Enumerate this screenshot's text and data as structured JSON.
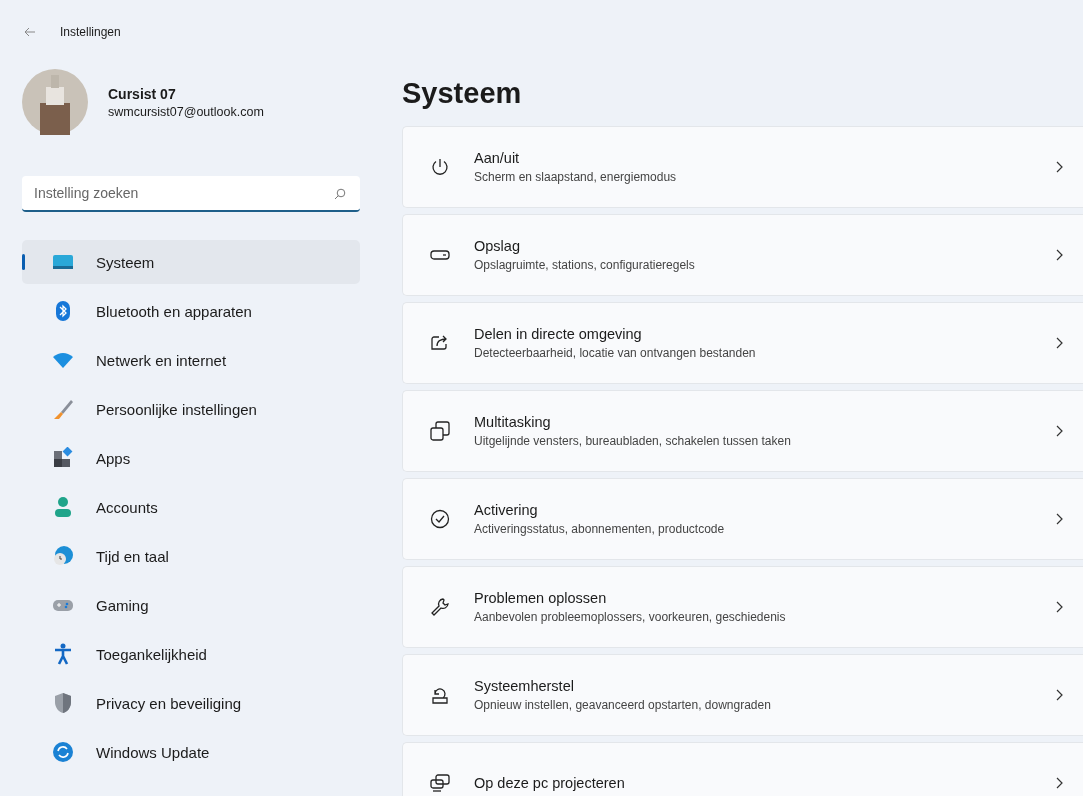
{
  "window": {
    "title": "Instellingen"
  },
  "profile": {
    "name": "Cursist 07",
    "email": "swmcursist07@outlook.com"
  },
  "search": {
    "placeholder": "Instelling zoeken"
  },
  "nav": [
    {
      "kind": "system",
      "label": "Systeem",
      "selected": true
    },
    {
      "kind": "bluetooth",
      "label": "Bluetooth en apparaten",
      "selected": false
    },
    {
      "kind": "network",
      "label": "Netwerk en internet",
      "selected": false
    },
    {
      "kind": "personalize",
      "label": "Persoonlijke instellingen",
      "selected": false
    },
    {
      "kind": "apps",
      "label": "Apps",
      "selected": false
    },
    {
      "kind": "accounts",
      "label": "Accounts",
      "selected": false
    },
    {
      "kind": "time",
      "label": "Tijd en taal",
      "selected": false
    },
    {
      "kind": "gaming",
      "label": "Gaming",
      "selected": false
    },
    {
      "kind": "accessibility",
      "label": "Toegankelijkheid",
      "selected": false
    },
    {
      "kind": "privacy",
      "label": "Privacy en beveiliging",
      "selected": false
    },
    {
      "kind": "update",
      "label": "Windows Update",
      "selected": false
    }
  ],
  "page": {
    "title": "Systeem"
  },
  "cards": [
    {
      "kind": "power",
      "title": "Aan/uit",
      "subtitle": "Scherm en slaapstand, energiemodus"
    },
    {
      "kind": "storage",
      "title": "Opslag",
      "subtitle": "Opslagruimte, stations, configuratieregels"
    },
    {
      "kind": "share",
      "title": "Delen in directe omgeving",
      "subtitle": "Detecteerbaarheid, locatie van ontvangen bestanden"
    },
    {
      "kind": "multitask",
      "title": "Multitasking",
      "subtitle": "Uitgelijnde vensters, bureaubladen, schakelen tussen taken"
    },
    {
      "kind": "activation",
      "title": "Activering",
      "subtitle": "Activeringsstatus, abonnementen, productcode"
    },
    {
      "kind": "troubleshoot",
      "title": "Problemen oplossen",
      "subtitle": "Aanbevolen probleemoplossers, voorkeuren, geschiedenis"
    },
    {
      "kind": "recovery",
      "title": "Systeemherstel",
      "subtitle": "Opnieuw instellen, geavanceerd opstarten, downgraden"
    },
    {
      "kind": "project",
      "title": "Op deze pc projecteren"
    }
  ]
}
